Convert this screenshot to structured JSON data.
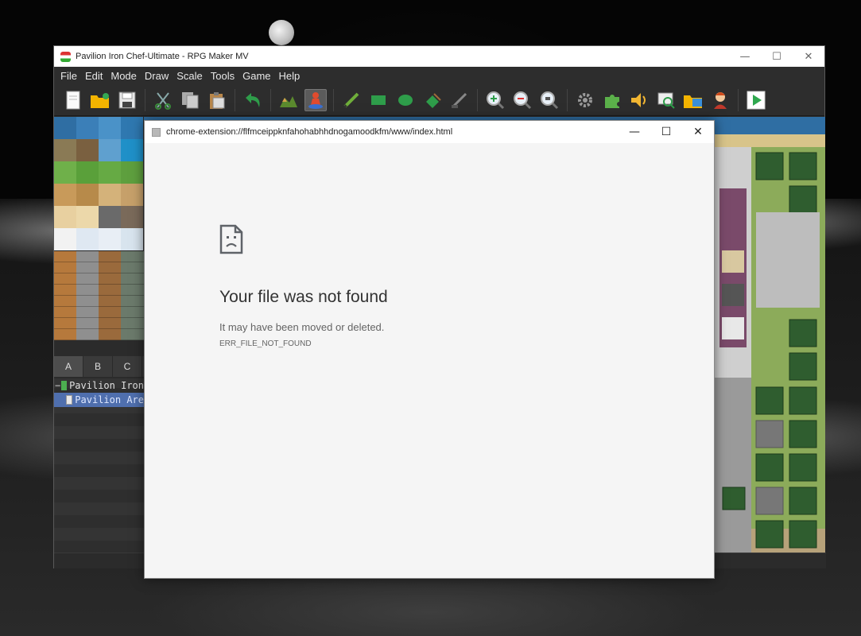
{
  "rpg_maker": {
    "title": "Pavilion Iron Chef-Ultimate - RPG Maker MV",
    "window_controls": {
      "minimize": "—",
      "maximize": "☐",
      "close": "✕"
    },
    "menu": [
      "File",
      "Edit",
      "Mode",
      "Draw",
      "Scale",
      "Tools",
      "Game",
      "Help"
    ],
    "toolbar_icons": [
      "new-project-icon",
      "open-project-icon",
      "save-project-icon",
      "cut-icon",
      "copy-icon",
      "paste-icon",
      "undo-icon",
      "map-mode-icon",
      "event-mode-icon",
      "pencil-icon",
      "rectangle-icon",
      "ellipse-icon",
      "fill-icon",
      "shadow-pen-icon",
      "zoom-in-icon",
      "zoom-out-icon",
      "actual-size-icon",
      "database-icon",
      "plugin-manager-icon",
      "sound-test-icon",
      "event-searcher-icon",
      "resource-manager-icon",
      "character-generator-icon",
      "playtest-icon"
    ],
    "tileset_tabs": [
      "A",
      "B",
      "C"
    ],
    "map_tree": [
      {
        "label": "Pavilion Iron",
        "expander": "−"
      },
      {
        "label": "Pavilion Are"
      }
    ]
  },
  "chrome_app": {
    "url": "chrome-extension://flfmceippknfahohabhhdnogamoodkfm/www/index.html",
    "window_controls": {
      "minimize": "—",
      "maximize": "☐",
      "close": "✕"
    },
    "error_title": "Your file was not found",
    "error_message": "It may have been moved or deleted.",
    "error_code": "ERR_FILE_NOT_FOUND"
  },
  "colors": {
    "menu_bg": "#2d2d2d",
    "selection": "#4f6fae",
    "error_bg": "#f5f5f5",
    "playtest_green": "#2fa84f"
  }
}
